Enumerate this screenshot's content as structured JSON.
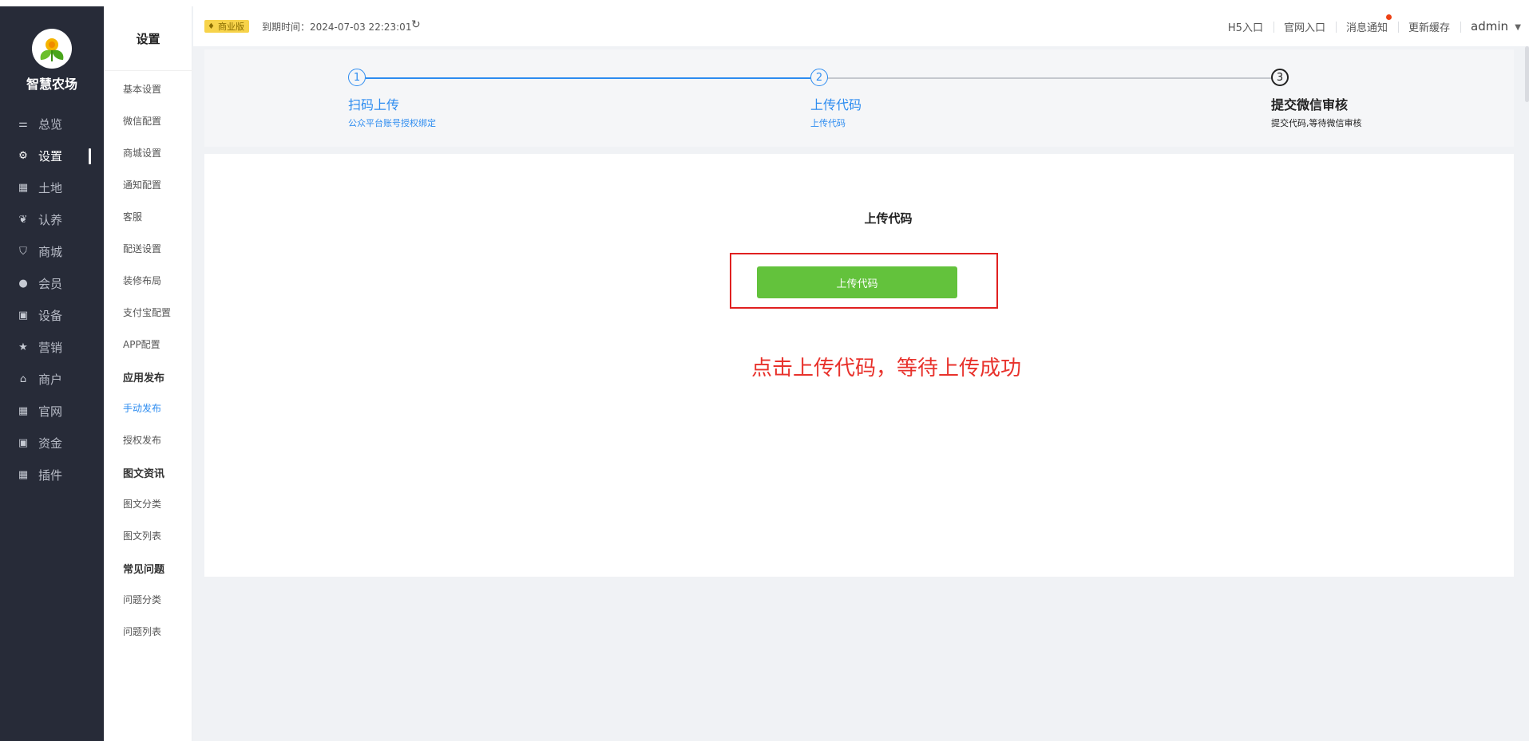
{
  "brand": "智慧农场",
  "nav": [
    {
      "label": "总览",
      "icon": "sliders-icon",
      "glyph": "⚌"
    },
    {
      "label": "设置",
      "icon": "gear-icon",
      "glyph": "⚙",
      "active": true
    },
    {
      "label": "土地",
      "icon": "grid-icon",
      "glyph": "▦"
    },
    {
      "label": "认养",
      "icon": "plant-icon",
      "glyph": "❦"
    },
    {
      "label": "商城",
      "icon": "bag-icon",
      "glyph": "⛉"
    },
    {
      "label": "会员",
      "icon": "user-icon",
      "glyph": "●"
    },
    {
      "label": "设备",
      "icon": "camera-icon",
      "glyph": "▣"
    },
    {
      "label": "营销",
      "icon": "star-icon",
      "glyph": "★"
    },
    {
      "label": "商户",
      "icon": "store-icon",
      "glyph": "⌂"
    },
    {
      "label": "官网",
      "icon": "grid-icon",
      "glyph": "▦"
    },
    {
      "label": "资金",
      "icon": "money-icon",
      "glyph": "▣"
    },
    {
      "label": "插件",
      "icon": "grid-icon",
      "glyph": "▦"
    }
  ],
  "submenu": {
    "title": "设置",
    "items": [
      {
        "label": "基本设置",
        "type": "link"
      },
      {
        "label": "微信配置",
        "type": "link"
      },
      {
        "label": "商城设置",
        "type": "link"
      },
      {
        "label": "通知配置",
        "type": "link"
      },
      {
        "label": "客服",
        "type": "link"
      },
      {
        "label": "配送设置",
        "type": "link"
      },
      {
        "label": "装修布局",
        "type": "link"
      },
      {
        "label": "支付宝配置",
        "type": "link"
      },
      {
        "label": "APP配置",
        "type": "link"
      },
      {
        "label": "应用发布",
        "type": "group"
      },
      {
        "label": "手动发布",
        "type": "link",
        "active": true
      },
      {
        "label": "授权发布",
        "type": "link"
      },
      {
        "label": "图文资讯",
        "type": "group"
      },
      {
        "label": "图文分类",
        "type": "link"
      },
      {
        "label": "图文列表",
        "type": "link"
      },
      {
        "label": "常见问题",
        "type": "group"
      },
      {
        "label": "问题分类",
        "type": "link"
      },
      {
        "label": "问题列表",
        "type": "link"
      }
    ]
  },
  "header": {
    "edition_badge": "商业版",
    "expiry": "到期时间：2024-07-03 22:23:01",
    "links": [
      "H5入口",
      "官网入口",
      "消息通知",
      "更新缓存"
    ],
    "user": "admin"
  },
  "steps": [
    {
      "num": "1",
      "title": "扫码上传",
      "desc": "公众平台账号授权绑定",
      "state": "done"
    },
    {
      "num": "2",
      "title": "上传代码",
      "desc": "上传代码",
      "state": "current"
    },
    {
      "num": "3",
      "title": "提交微信审核",
      "desc": "提交代码,等待微信审核",
      "state": "pending"
    }
  ],
  "content": {
    "title": "上传代码",
    "button": "上传代码",
    "note": "点击上传代码，等待上传成功"
  },
  "colors": {
    "nav_bg": "#272b38",
    "accent_blue": "#2d8cf0",
    "button_green": "#63c23c",
    "annotation_red": "#e8322c",
    "badge_yellow": "#f7d34a"
  }
}
